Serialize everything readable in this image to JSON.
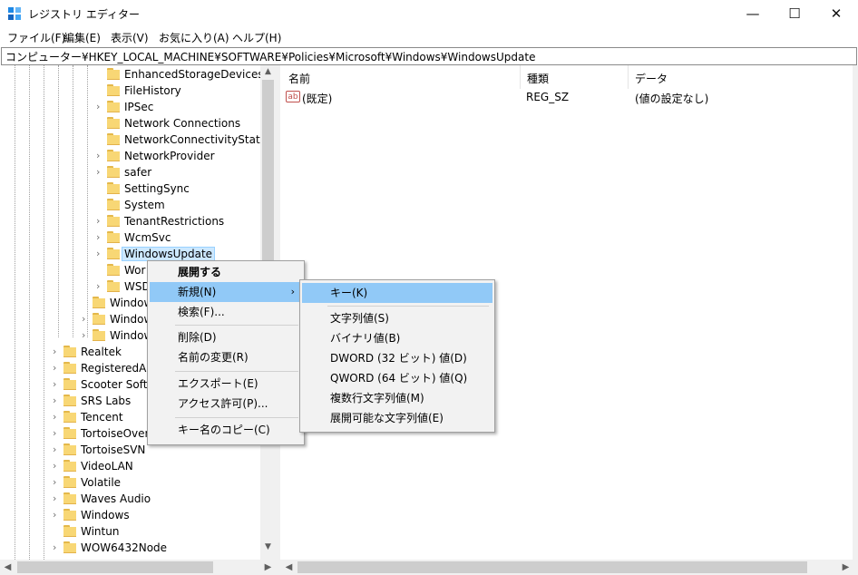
{
  "window": {
    "title": "レジストリ エディター",
    "minimize": "—",
    "maximize": "☐",
    "close": "✕"
  },
  "menu": [
    "ファイル(F)",
    "編集(E)",
    "表示(V)",
    "お気に入り(A)",
    "ヘルプ(H)"
  ],
  "address": "コンピューター¥HKEY_LOCAL_MACHINE¥SOFTWARE¥Policies¥Microsoft¥Windows¥WindowsUpdate",
  "tree": {
    "items": [
      {
        "label": "EnhancedStorageDevices",
        "expandable": false
      },
      {
        "label": "FileHistory",
        "expandable": false
      },
      {
        "label": "IPSec",
        "expandable": true
      },
      {
        "label": "Network Connections",
        "expandable": false
      },
      {
        "label": "NetworkConnectivityStatusI",
        "expandable": false
      },
      {
        "label": "NetworkProvider",
        "expandable": true
      },
      {
        "label": "safer",
        "expandable": true
      },
      {
        "label": "SettingSync",
        "expandable": false
      },
      {
        "label": "System",
        "expandable": false
      },
      {
        "label": "TenantRestrictions",
        "expandable": true
      },
      {
        "label": "WcmSvc",
        "expandable": true
      },
      {
        "label": "WindowsUpdate",
        "expandable": true,
        "selected": true
      },
      {
        "label": "Wor",
        "expandable": false
      },
      {
        "label": "WSD",
        "expandable": true
      },
      {
        "label": "Window",
        "expandable": false
      },
      {
        "label": "Window",
        "expandable": true
      },
      {
        "label": "Window",
        "expandable": true
      },
      {
        "label": "Realtek",
        "expandable": true
      },
      {
        "label": "RegisteredAp",
        "expandable": true
      },
      {
        "label": "Scooter Softw",
        "expandable": true
      },
      {
        "label": "SRS Labs",
        "expandable": true
      },
      {
        "label": "Tencent",
        "expandable": true
      },
      {
        "label": "TortoiseOverl",
        "expandable": true
      },
      {
        "label": "TortoiseSVN",
        "expandable": true
      },
      {
        "label": "VideoLAN",
        "expandable": true
      },
      {
        "label": "Volatile",
        "expandable": true
      },
      {
        "label": "Waves Audio",
        "expandable": true
      },
      {
        "label": "Windows",
        "expandable": true
      },
      {
        "label": "Wintun",
        "expandable": false
      },
      {
        "label": "WOW6432Node",
        "expandable": true
      }
    ]
  },
  "list": {
    "headers": {
      "name": "名前",
      "type": "種類",
      "data": "データ"
    },
    "rows": [
      {
        "icon": "ab",
        "name": "(既定)",
        "type": "REG_SZ",
        "data": "(値の設定なし)"
      }
    ]
  },
  "context_menu": {
    "expand": "展開する",
    "new": "新規(N)",
    "find": "検索(F)...",
    "delete": "削除(D)",
    "rename": "名前の変更(R)",
    "export": "エクスポート(E)",
    "permissions": "アクセス許可(P)...",
    "copy_key_name": "キー名のコピー(C)"
  },
  "submenu": {
    "key": "キー(K)",
    "string_value": "文字列値(S)",
    "binary_value": "バイナリ値(B)",
    "dword_value": "DWORD (32 ビット) 値(D)",
    "qword_value": "QWORD (64 ビット) 値(Q)",
    "multi_string_value": "複数行文字列値(M)",
    "expandable_string_value": "展開可能な文字列値(E)"
  },
  "colors": {
    "highlight": "#91c9f7",
    "selection": "#cce8ff",
    "folder": "#f8d775"
  }
}
